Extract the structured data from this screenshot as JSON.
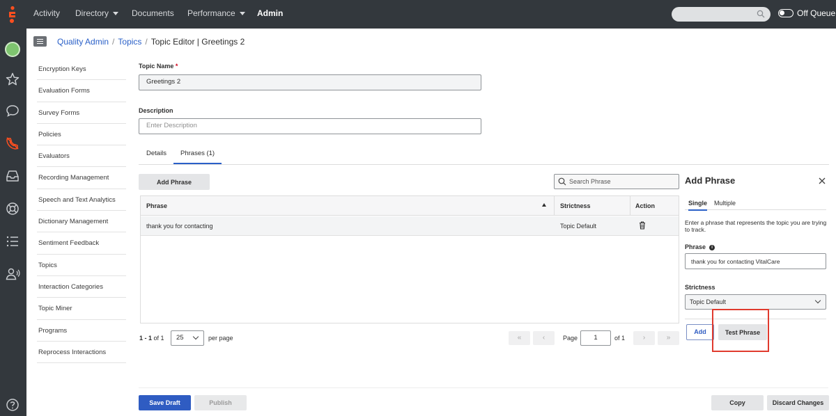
{
  "topnav": {
    "items": [
      {
        "label": "Activity",
        "has_caret": false
      },
      {
        "label": "Directory",
        "has_caret": true
      },
      {
        "label": "Documents",
        "has_caret": false
      },
      {
        "label": "Performance",
        "has_caret": true
      },
      {
        "label": "Admin",
        "has_caret": false,
        "active": true
      }
    ],
    "search_placeholder": "",
    "queue_label": "Off Queue",
    "queue_toggle_on": false
  },
  "rail": {
    "icons": [
      "avatar",
      "star-icon",
      "chat-icon",
      "phone-off-icon",
      "inbox-icon",
      "lifebuoy-icon",
      "list-icon",
      "agent-icon",
      "help-icon"
    ]
  },
  "breadcrumb": {
    "items": [
      "Quality Admin",
      "Topics"
    ],
    "current": "Topic Editor | Greetings 2"
  },
  "sidemenu": {
    "items": [
      "Encryption Keys",
      "Evaluation Forms",
      "Survey Forms",
      "Policies",
      "Evaluators",
      "Recording Management",
      "Speech and Text Analytics",
      "Dictionary Management",
      "Sentiment Feedback",
      "Topics",
      "Interaction Categories",
      "Topic Miner",
      "Programs",
      "Reprocess Interactions"
    ]
  },
  "form": {
    "topic_name_label": "Topic Name",
    "required_mark": "*",
    "topic_name_value": "Greetings 2",
    "description_label": "Description",
    "description_placeholder": "Enter Description"
  },
  "tabs": {
    "details": "Details",
    "phrases": "Phrases (1)"
  },
  "phrases": {
    "add_button": "Add Phrase",
    "search_placeholder": "Search Phrase",
    "columns": [
      "Phrase",
      "Strictness",
      "Action"
    ],
    "rows": [
      {
        "phrase": "thank you for contacting",
        "strictness": "Topic Default"
      }
    ]
  },
  "pagination": {
    "range_bold": "1 - 1",
    "range_of": "of 1",
    "per_page_value": "25",
    "per_page_label": "per page",
    "page_label": "Page",
    "page_value": "1",
    "page_of": "of 1",
    "first_glyph": "«",
    "prev_glyph": "‹",
    "next_glyph": "›",
    "last_glyph": "»"
  },
  "panel": {
    "title": "Add Phrase",
    "tab_single": "Single",
    "tab_multiple": "Multiple",
    "description": "Enter a phrase that represents the topic you are trying to track.",
    "phrase_label": "Phrase",
    "phrase_value": "thank you for contacting VitalCare",
    "strictness_label": "Strictness",
    "strictness_value": "Topic Default",
    "add_button": "Add",
    "test_button": "Test Phrase"
  },
  "footer": {
    "save_draft": "Save Draft",
    "publish": "Publish",
    "copy": "Copy",
    "discard": "Discard Changes"
  },
  "colors": {
    "nav_bg": "#33383d",
    "brand_orange": "#ff4f1f",
    "primary_blue": "#2f5cc2",
    "highlight_red": "#e03a2e"
  }
}
